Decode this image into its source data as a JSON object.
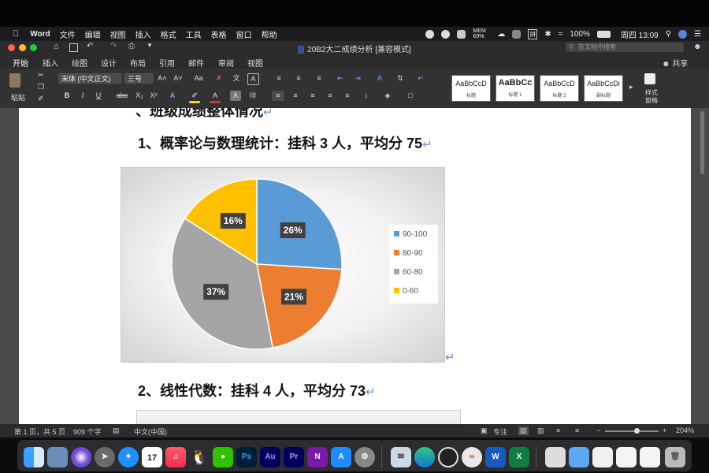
{
  "menubar": {
    "app_name": "Word",
    "items": [
      "文件",
      "编辑",
      "视图",
      "插入",
      "格式",
      "工具",
      "表格",
      "窗口",
      "帮助"
    ],
    "memory": "MEM 69%",
    "input_method": "拼",
    "battery": "100%",
    "clock": "周四 13:09"
  },
  "titlebar": {
    "document_title": "20B2大二成绩分析 [兼容模式]",
    "search_placeholder": "在文档中搜索",
    "share_label": "共享"
  },
  "ribbon": {
    "tabs": [
      "开始",
      "插入",
      "绘图",
      "设计",
      "布局",
      "引用",
      "邮件",
      "审阅",
      "视图"
    ],
    "active_tab": "开始",
    "paste_label": "粘贴",
    "font_name": "宋体 (中文正文)",
    "font_size": "三号",
    "bold": "B",
    "italic": "I",
    "underline": "U",
    "strikethrough": "abc",
    "subscript": "X₂",
    "superscript": "X²",
    "font_color_a": "A",
    "styles": [
      {
        "sample": "AaBbCcD",
        "name": "标题"
      },
      {
        "sample": "AaBbCc",
        "name": "标题 1"
      },
      {
        "sample": "AaBbCcD",
        "name": "标题 2"
      },
      {
        "sample": "AaBbCcDi",
        "name": "副标题"
      }
    ],
    "styles_pane": [
      "样式",
      "窗格"
    ]
  },
  "document": {
    "heading_partial": "、班级成绩整体情况",
    "section1": "1、概率论与数理统计：挂科 3 人，平均分 75",
    "section2": "2、线性代数：挂科 4 人，平均分 73",
    "paragraph_mark": "↵"
  },
  "chart_data": {
    "type": "pie",
    "categories": [
      "90-100",
      "80-90",
      "60-80",
      "0-60"
    ],
    "values": [
      26,
      21,
      37,
      16
    ],
    "labels": [
      "26%",
      "21%",
      "37%",
      "16%"
    ],
    "colors": [
      "#5b9bd5",
      "#ed7d31",
      "#a5a5a5",
      "#ffc000"
    ],
    "legend_position": "right"
  },
  "statusbar": {
    "page": "第 1 页，共 5 页",
    "words": "909 个字",
    "language": "中文(中国)",
    "focus": "专注",
    "zoom": "204%"
  },
  "dock": {
    "calendar_month": "7月",
    "calendar_day": "17",
    "apps": [
      "Finder",
      "Preview",
      "Siri",
      "Launchpad",
      "Safari",
      "Calendar",
      "Music",
      "QQ",
      "WeChat",
      "Photoshop",
      "Audition",
      "Premiere",
      "OneNote",
      "App Store",
      "System Preferences",
      "Mail",
      "Edge",
      "OBS",
      "Connect",
      "Word",
      "Excel",
      "Downloads",
      "Trash"
    ],
    "ps": "Ps",
    "au": "Au",
    "pr": "Pr",
    "on": "N",
    "wd": "W",
    "xl": "X"
  }
}
